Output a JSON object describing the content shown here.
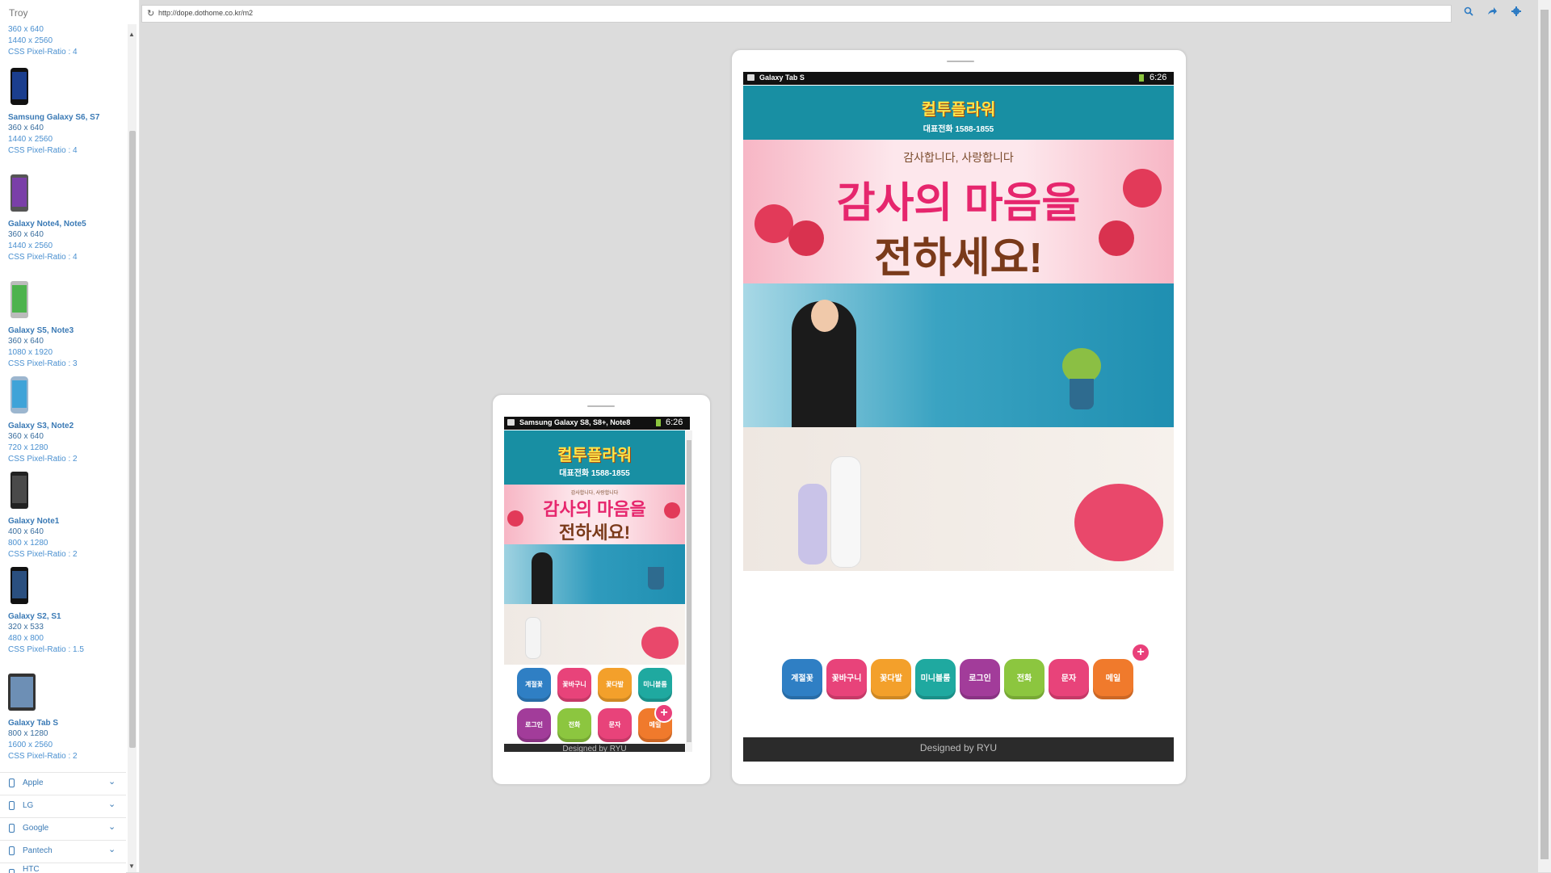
{
  "sidebar": {
    "title": "Troy",
    "top_partial": [
      "360 x 640",
      "1440 x 2560",
      "CSS Pixel-Ratio : 4"
    ],
    "devices": [
      {
        "name": "Samsung Galaxy S6, S7",
        "specs": [
          "360 x 640",
          "1440 x 2560",
          "CSS Pixel-Ratio : 4"
        ]
      },
      {
        "name": "Galaxy Note4, Note5",
        "specs": [
          "360 x 640",
          "1440 x 2560",
          "CSS Pixel-Ratio : 4"
        ]
      },
      {
        "name": "Galaxy S5, Note3",
        "specs": [
          "360 x 640",
          "1080 x 1920",
          "CSS Pixel-Ratio : 3"
        ]
      },
      {
        "name": "Galaxy S3, Note2",
        "specs": [
          "360 x 640",
          "720 x 1280",
          "CSS Pixel-Ratio : 2"
        ]
      },
      {
        "name": "Galaxy Note1",
        "specs": [
          "400 x 640",
          "800 x 1280",
          "CSS Pixel-Ratio : 2"
        ]
      },
      {
        "name": "Galaxy S2, S1",
        "specs": [
          "320 x 533",
          "480 x 800",
          "CSS Pixel-Ratio : 1.5"
        ]
      },
      {
        "name": "Galaxy Tab S",
        "specs": [
          "800 x 1280",
          "1600 x 2560",
          "CSS Pixel-Ratio : 2"
        ]
      }
    ],
    "categories": [
      "Apple",
      "LG",
      "Google",
      "Pantech",
      "HTC"
    ]
  },
  "urlbar": {
    "url": "http://dope.dothome.co.kr/m2"
  },
  "colors": {
    "header_teal": "#188fa3",
    "link_blue": "#3b7ab5"
  },
  "site": {
    "logo": "컬투플라워",
    "phone": "대표전화 1588-1855",
    "banner1_small": "감사합니다, 사랑합니다",
    "banner1_line1": "감사의 마음을",
    "banner1_line2": "전하세요!",
    "footer": "Designed by RYU",
    "menu": [
      {
        "label": "계절꽃",
        "color": "#2f7fc4"
      },
      {
        "label": "꽃바구니",
        "color": "#e8437a"
      },
      {
        "label": "꽃다발",
        "color": "#f3a02b"
      },
      {
        "label": "미니블룸",
        "color": "#1fa9a0"
      },
      {
        "label": "로그인",
        "color": "#a23c9a"
      },
      {
        "label": "전화",
        "color": "#8cc63f"
      },
      {
        "label": "문자",
        "color": "#e8437a"
      },
      {
        "label": "메일",
        "color": "#f07a2c"
      }
    ],
    "plus": "+"
  },
  "phone_preview": {
    "status_title": "Samsung Galaxy S8, S8+, Note8",
    "time": "6:26"
  },
  "tablet_preview": {
    "status_title": "Galaxy Tab S",
    "time": "6:26"
  }
}
